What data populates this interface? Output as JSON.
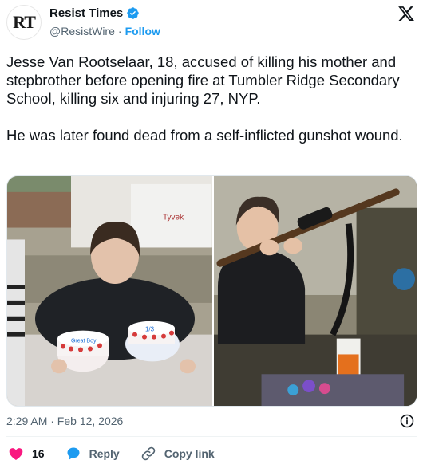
{
  "header": {
    "avatar_text": "RT",
    "display_name": "Resist Times",
    "handle": "@ResistWire",
    "separator": "·",
    "follow_label": "Follow"
  },
  "tweet": {
    "text": "Jesse Van Rootselaar, 18, accused of killing his mother and stepbrother before opening fire at Tumbler Ridge Secondary School, killing six and injuring 27, NYP.\n\nHe was later found dead from a self-inflicted gunshot wound."
  },
  "media": {
    "left_photo": {
      "icon": "photo",
      "cake_left_text": "Great Boy",
      "cake_right_text": "1/3",
      "wrap_text": "Tyvek"
    },
    "right_photo": {
      "icon": "photo"
    }
  },
  "meta": {
    "timestamp": "2:29 AM · Feb 12, 2026"
  },
  "actions": {
    "like_count": "16",
    "reply_label": "Reply",
    "copy_link_label": "Copy link"
  },
  "colors": {
    "accent": "#1d9bf0",
    "like": "#f91880",
    "muted": "#536471"
  }
}
